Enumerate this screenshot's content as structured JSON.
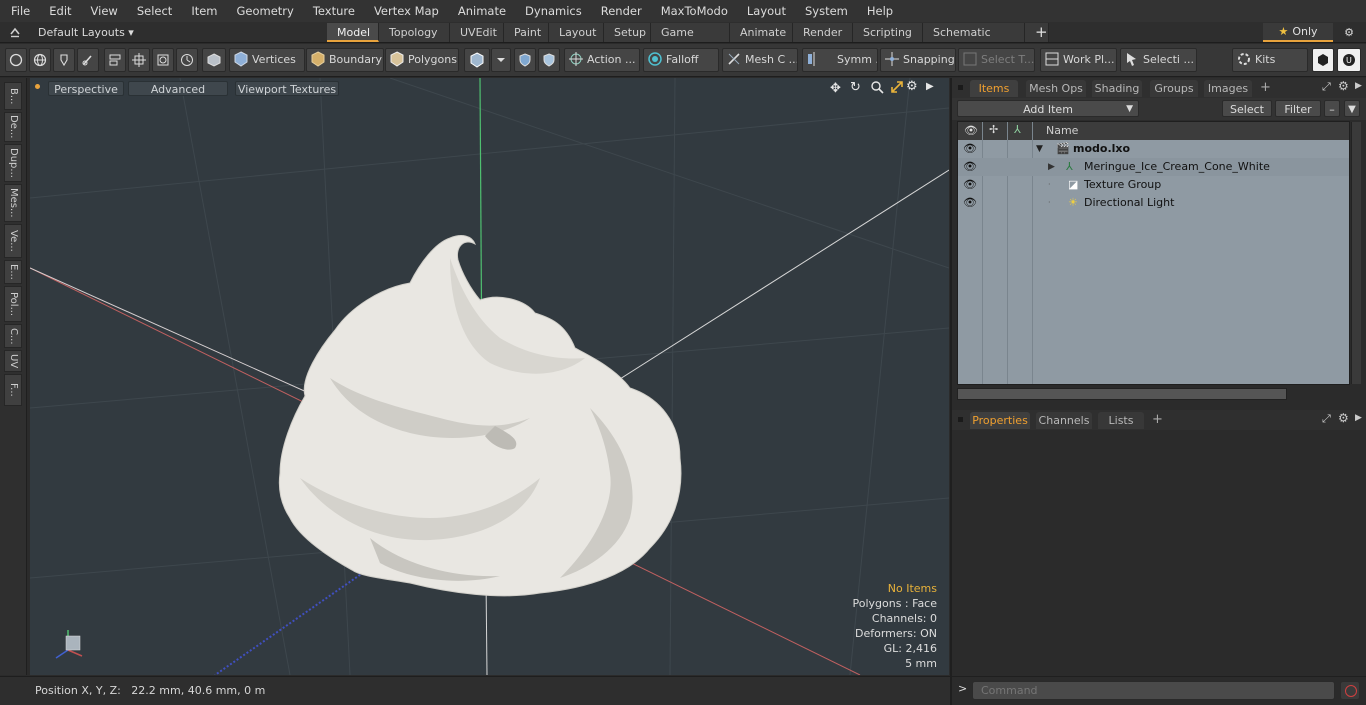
{
  "menu": [
    "File",
    "Edit",
    "View",
    "Select",
    "Item",
    "Geometry",
    "Texture",
    "Vertex Map",
    "Animate",
    "Dynamics",
    "Render",
    "MaxToModo",
    "Layout",
    "System",
    "Help"
  ],
  "layout": {
    "selector": "Default Layouts ▾",
    "tabs": [
      "Model",
      "Topology",
      "UVEdit",
      "Paint",
      "Layout",
      "Setup",
      "Game Tools",
      "Animate",
      "Render",
      "Scripting",
      "Schematic Fusion"
    ],
    "active_tab": "Model",
    "add_tab": "+",
    "only_label": "Only"
  },
  "toolbar": {
    "vertices": "Vertices",
    "boundary": "Boundary",
    "polygons": "Polygons",
    "action": "Action ...",
    "falloff": "Falloff",
    "mesh": "Mesh C ...",
    "symm": "Symm ...",
    "snapping": "Snapping",
    "select_t": "Select T...",
    "work_pl": "Work Pl...",
    "selecti": "Selecti ...",
    "kits": "Kits"
  },
  "left_tabs": [
    "B...",
    "De...",
    "Dup...",
    "Mes...",
    "Ve...",
    "E...",
    "Pol...",
    "C...",
    "UV",
    "F..."
  ],
  "viewport": {
    "perspective": "Perspective",
    "advanced": "Advanced",
    "textures": "Viewport Textures",
    "stats": {
      "no_items": "No Items",
      "polygons": "Polygons : Face",
      "channels": "Channels: 0",
      "deformers": "Deformers: ON",
      "gl": "GL: 2,416",
      "unit": "5 mm"
    }
  },
  "status": {
    "position": "Position X, Y, Z:   22.2 mm, 40.6 mm, 0 m"
  },
  "items_panel": {
    "tabs": [
      "Items",
      "Mesh Ops",
      "Shading",
      "Groups",
      "Images"
    ],
    "active": "Items",
    "add_tab": "+",
    "add_item": "Add Item",
    "select": "Select",
    "filter": "Filter",
    "column_name": "Name",
    "rows": [
      {
        "label": "modo.lxo"
      },
      {
        "label": "Meringue_Ice_Cream_Cone_White"
      },
      {
        "label": "Texture Group"
      },
      {
        "label": "Directional Light"
      }
    ]
  },
  "properties_panel": {
    "tabs": [
      "Properties",
      "Channels",
      "Lists"
    ],
    "active": "Properties",
    "add_tab": "+"
  },
  "command": {
    "prompt": ">",
    "placeholder": "Command"
  },
  "colors": {
    "accent": "#e8a33d",
    "viewport_bg": "#323a40",
    "meringue": "#e8e6e1"
  }
}
